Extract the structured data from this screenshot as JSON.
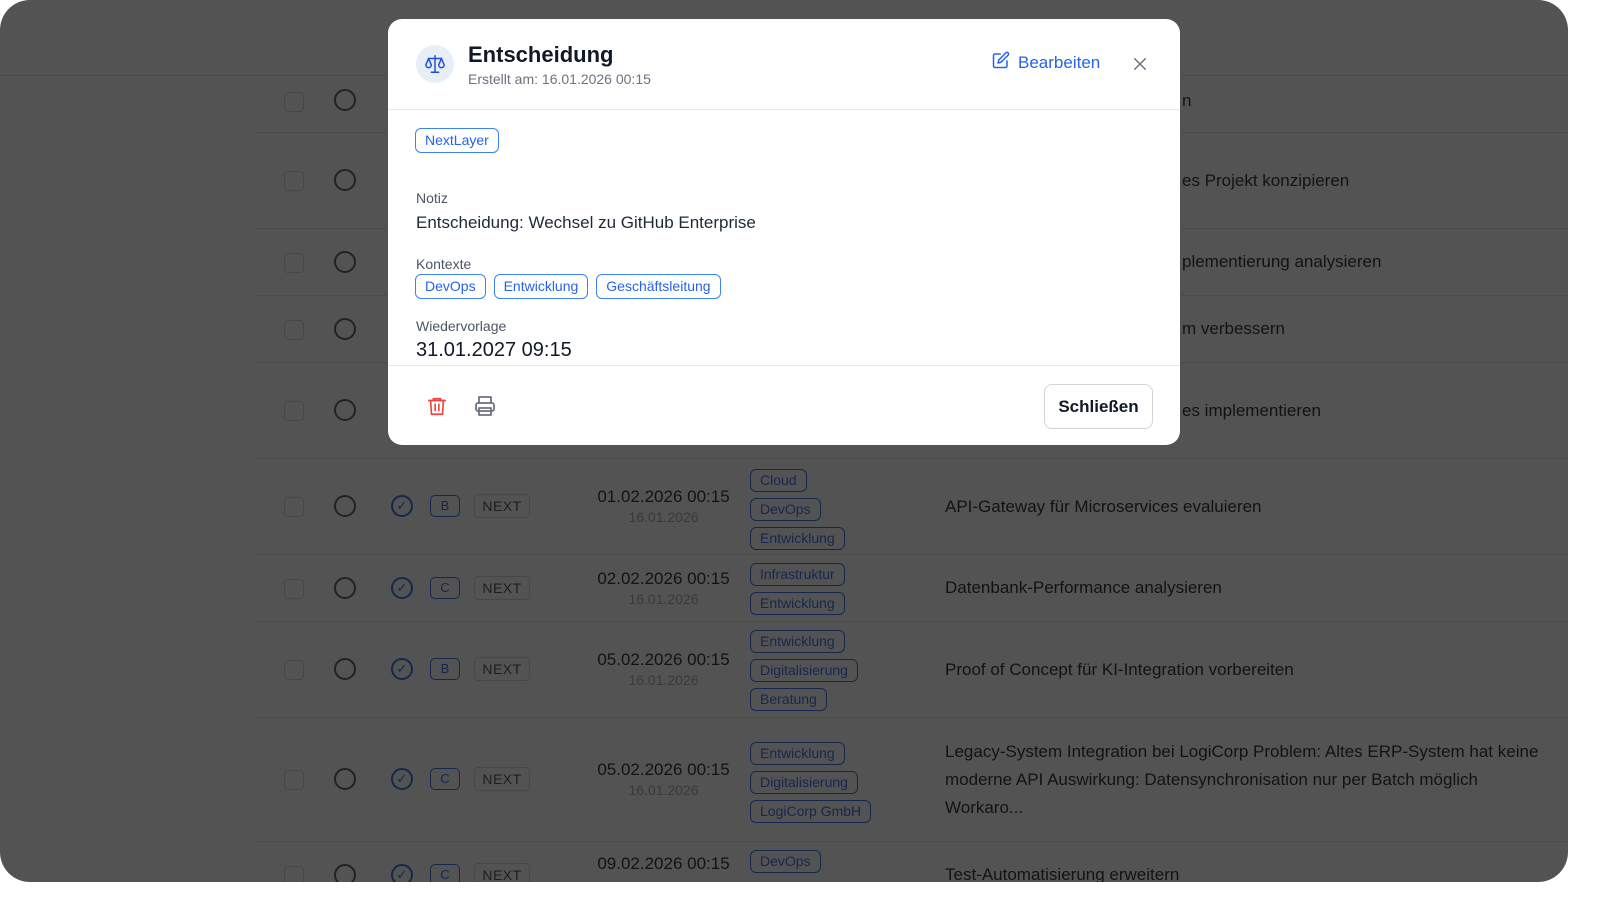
{
  "modal": {
    "title": "Entscheidung",
    "created": "Erstellt am: 16.01.2026 00:15",
    "edit_label": "Bearbeiten",
    "project_tag": "NextLayer",
    "notiz_label": "Notiz",
    "notiz_value": "Entscheidung: Wechsel zu GitHub Enterprise",
    "kontexte_label": "Kontexte",
    "kontexte": [
      "DevOps",
      "Entwicklung",
      "Geschäftsleitung"
    ],
    "wiedervorlage_label": "Wiedervorlage",
    "wiedervorlage_value": "31.01.2027 09:15",
    "close_button": "Schließen",
    "icons": {
      "avatar": "scale-icon",
      "edit": "edit-icon",
      "close": "close-icon",
      "delete": "trash-icon",
      "print": "printer-icon"
    },
    "colors": {
      "accent": "#2563eb",
      "danger": "#ef4444"
    }
  },
  "rows": [
    {
      "title_partial": "n"
    },
    {
      "title_partial": "es Projekt konzipieren"
    },
    {
      "title_partial": "plementierung analysieren"
    },
    {
      "title_partial": "m verbessern"
    },
    {
      "title_partial": "es implementieren"
    },
    {
      "prio": "B",
      "status": "NEXT",
      "date": "01.02.2026 00:15",
      "created": "16.01.2026",
      "tags": [
        "Cloud",
        "DevOps",
        "Entwicklung"
      ],
      "title": "API-Gateway für Microservices evaluieren"
    },
    {
      "prio": "C",
      "status": "NEXT",
      "date": "02.02.2026 00:15",
      "created": "16.01.2026",
      "tags": [
        "Infrastruktur",
        "Entwicklung"
      ],
      "title": "Datenbank-Performance analysieren"
    },
    {
      "prio": "B",
      "status": "NEXT",
      "date": "05.02.2026 00:15",
      "created": "16.01.2026",
      "tags": [
        "Entwicklung",
        "Digitalisierung",
        "Beratung"
      ],
      "title": "Proof of Concept für KI-Integration vorbereiten"
    },
    {
      "prio": "C",
      "status": "NEXT",
      "date": "05.02.2026 00:15",
      "created": "16.01.2026",
      "tags": [
        "Entwicklung",
        "Digitalisierung",
        "LogiCorp GmbH"
      ],
      "title": "Legacy-System Integration bei LogiCorp Problem: Altes ERP-System hat keine moderne API Auswirkung: Datensynchronisation nur per Batch möglich Workaro..."
    },
    {
      "prio": "C",
      "status": "NEXT",
      "date": "09.02.2026 00:15",
      "tags": [
        "DevOps"
      ],
      "title": "Test-Automatisierung erweitern"
    }
  ]
}
